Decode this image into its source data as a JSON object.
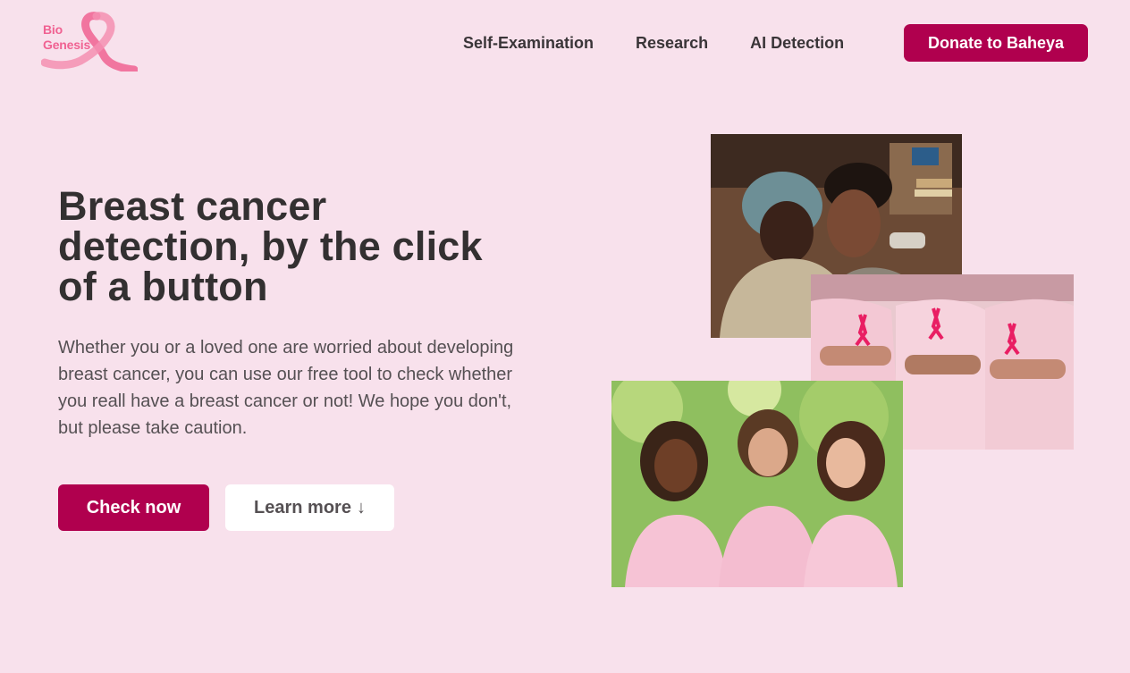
{
  "logo": {
    "line1": "Bio",
    "line2": "Genesis",
    "icon": "pink-ribbon-icon"
  },
  "nav": {
    "items": [
      {
        "label": "Self-Examination"
      },
      {
        "label": "Research"
      },
      {
        "label": "AI Detection"
      }
    ],
    "donate_label": "Donate to Baheya"
  },
  "hero": {
    "title": "Breast cancer detection, by the click of a button",
    "description": "Whether you or a loved one are worried about developing breast cancer, you can use our free tool to check whether you reall have a breast cancer or not! We hope you don't, but please take caution.",
    "primary_button": "Check now",
    "secondary_button": "Learn more",
    "secondary_arrow": "↓"
  },
  "colors": {
    "background": "#f8e1ec",
    "accent": "#b0004e",
    "logo_pink": "#f06292"
  }
}
